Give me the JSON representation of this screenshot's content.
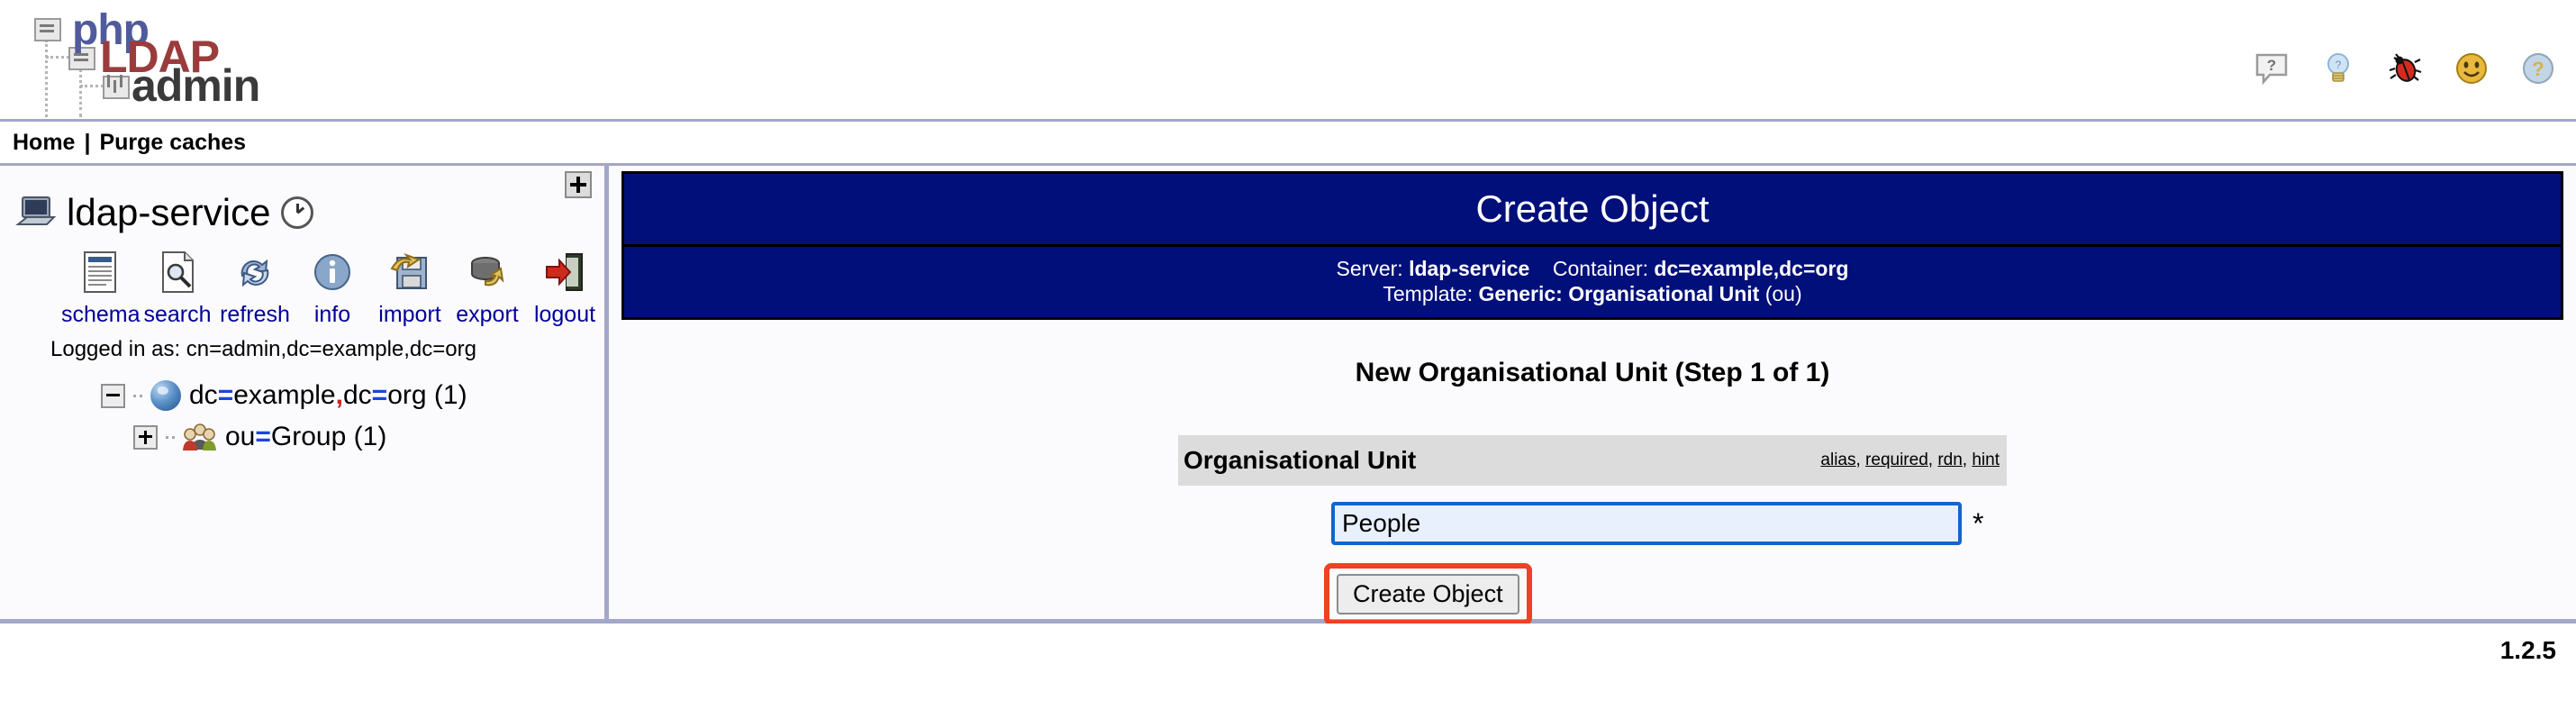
{
  "app": {
    "logo_php": "php",
    "logo_ldap": "LDAP",
    "logo_admin": "admin",
    "version": "1.2.5"
  },
  "header": {
    "icons": [
      {
        "name": "help-balloon-icon",
        "label": "?"
      },
      {
        "name": "lightbulb-hint-icon",
        "label": "hint"
      },
      {
        "name": "bug-report-icon",
        "label": "bug"
      },
      {
        "name": "smiley-donate-icon",
        "label": "donate"
      },
      {
        "name": "globe-help-icon",
        "label": "help"
      }
    ]
  },
  "navbar": {
    "home": "Home",
    "separator": "|",
    "purge_caches": "Purge caches"
  },
  "sidebar": {
    "expand_button": "+",
    "server_name": "ldap-service",
    "toolbar": [
      {
        "name": "schema",
        "label": "schema"
      },
      {
        "name": "search",
        "label": "search"
      },
      {
        "name": "refresh",
        "label": "refresh"
      },
      {
        "name": "info",
        "label": "info"
      },
      {
        "name": "import",
        "label": "import"
      },
      {
        "name": "export",
        "label": "export"
      },
      {
        "name": "logout",
        "label": "logout"
      }
    ],
    "logged_in_as": "Logged in as: cn=admin,dc=example,dc=org",
    "tree": [
      {
        "prefix": "dc",
        "eq": "=",
        "mid": "example",
        "comma": ",",
        "prefix2": "dc",
        "eq2": "=",
        "suffix": "org",
        "count": "(1)",
        "toggle": "minus"
      },
      {
        "prefix": "ou",
        "eq": "=",
        "mid": "Group",
        "count": "(1)",
        "toggle": "plus"
      }
    ]
  },
  "main": {
    "title": "Create Object",
    "server_label": "Server:",
    "server_value": "ldap-service",
    "container_label": "Container:",
    "container_value": "dc=example,dc=org",
    "template_label": "Template:",
    "template_value": "Generic: Organisational Unit",
    "template_suffix": "(ou)",
    "step_title": "New Organisational Unit (Step 1 of 1)",
    "attribute_name": "Organisational Unit",
    "attribute_links": [
      {
        "label": "alias"
      },
      {
        "label": "required"
      },
      {
        "label": "rdn"
      },
      {
        "label": "hint"
      }
    ],
    "attribute_links_separator": ", ",
    "input_value": "People",
    "input_placeholder": "",
    "required_marker": "*",
    "create_button": "Create Object"
  },
  "colors": {
    "panel_header_blue": "#000f7a",
    "link_blue": "#00009a",
    "highlight_red": "#ef4123",
    "border_lavender": "#a3a7c8",
    "attr_header_grey": "#dcdcdc",
    "input_focus_blue": "#1664c8"
  }
}
